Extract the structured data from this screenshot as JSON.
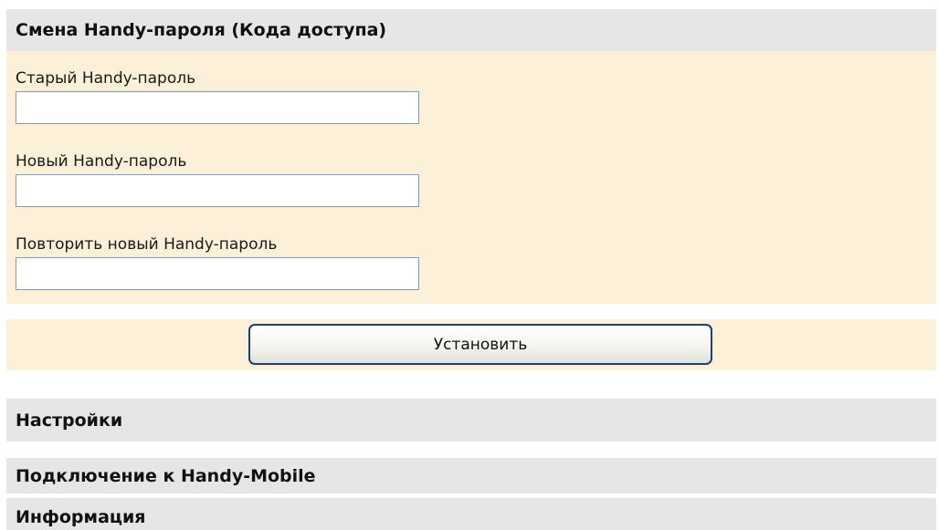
{
  "password_section": {
    "title": "Смена Handy-пароля (Кода доступа)",
    "old_password": {
      "label": "Старый Handy-пароль",
      "value": ""
    },
    "new_password": {
      "label": "Новый Handy-пароль",
      "value": ""
    },
    "repeat_password": {
      "label": "Повторить новый Handy-пароль",
      "value": ""
    },
    "submit_label": "Установить"
  },
  "sections": {
    "settings": "Настройки",
    "connection": "Подключение к Handy-Mobile",
    "information": "Информация"
  },
  "colors": {
    "header_bg": "#e6e6e6",
    "panel_bg": "#fcf0d8",
    "input_border": "#7f9db9",
    "button_border": "#1f3f73"
  }
}
